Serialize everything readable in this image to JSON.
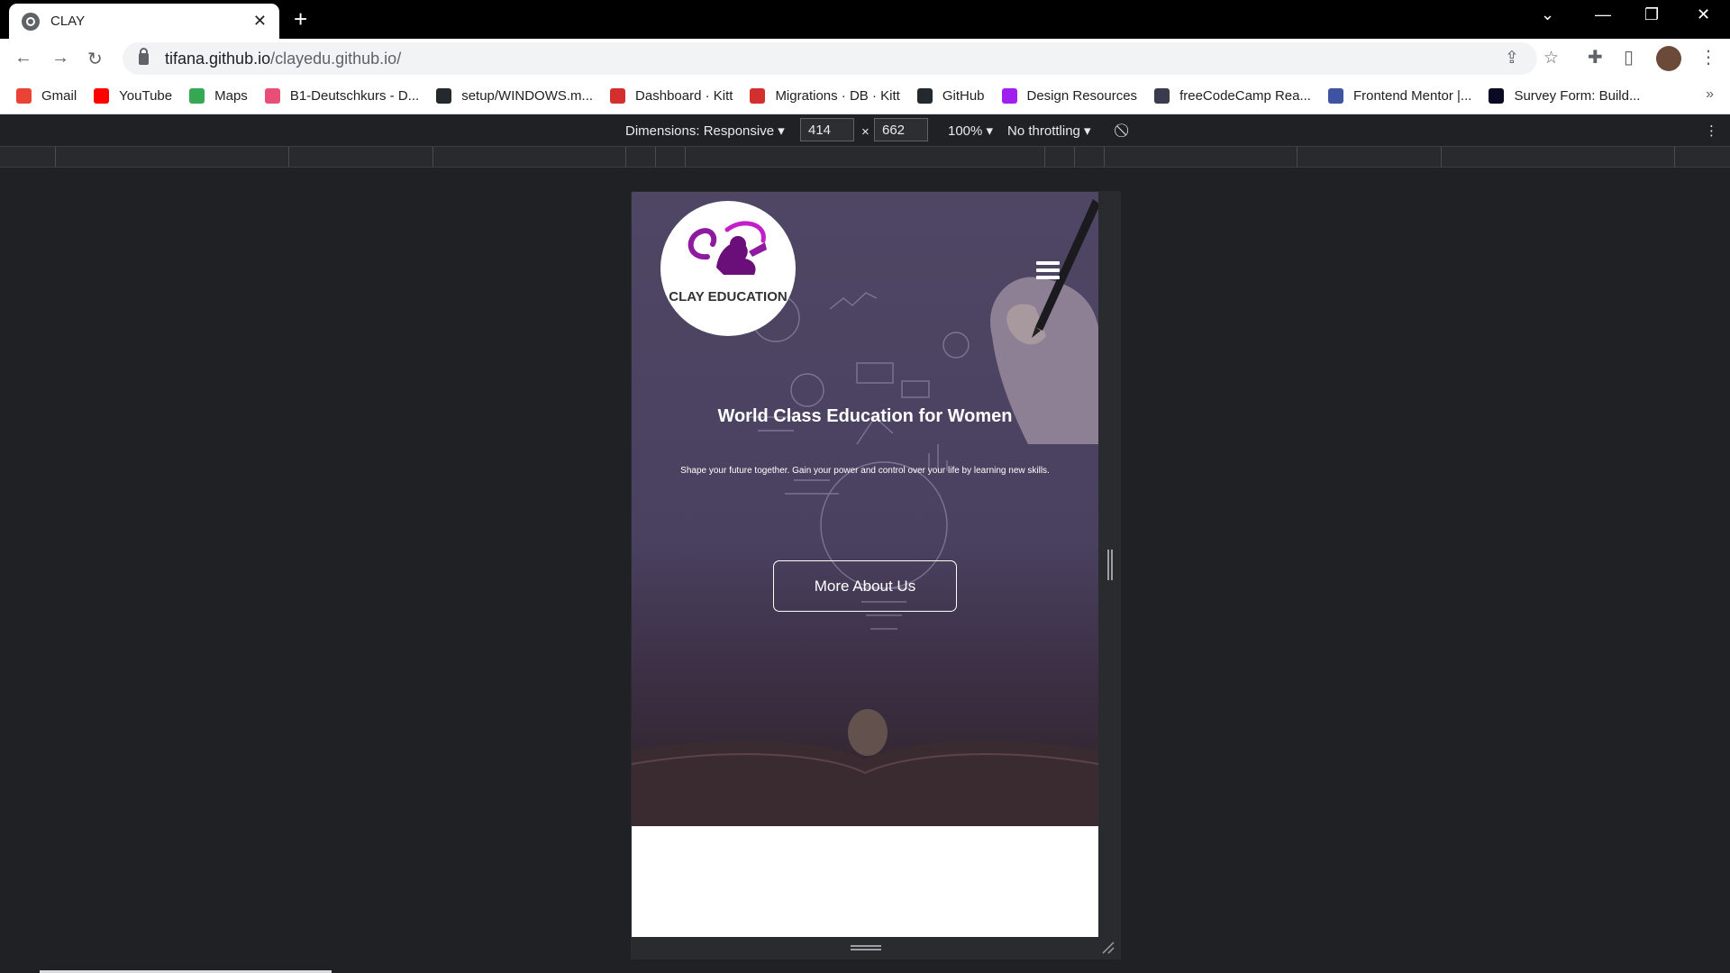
{
  "browser": {
    "tab_title": "CLAY",
    "url_host": "tifana.github.io",
    "url_path": "/clayedu.github.io/",
    "bookmarks": [
      {
        "label": "Gmail",
        "color": "#ea4335"
      },
      {
        "label": "YouTube",
        "color": "#ff0000"
      },
      {
        "label": "Maps",
        "color": "#34a853"
      },
      {
        "label": "B1-Deutschkurs - D...",
        "color": "#e94e77"
      },
      {
        "label": "setup/WINDOWS.m...",
        "color": "#24292e"
      },
      {
        "label": "Dashboard · Kitt",
        "color": "#d32f2f"
      },
      {
        "label": "Migrations · DB · Kitt",
        "color": "#d32f2f"
      },
      {
        "label": "GitHub",
        "color": "#24292e"
      },
      {
        "label": "Design Resources",
        "color": "#a020f0"
      },
      {
        "label": "freeCodeCamp Rea...",
        "color": "#3b3b4f"
      },
      {
        "label": "Frontend Mentor |...",
        "color": "#3e54a3"
      },
      {
        "label": "Survey Form: Build...",
        "color": "#0a0a23"
      }
    ]
  },
  "devtools": {
    "dimensions_label": "Dimensions: Responsive",
    "width": "414",
    "times": "×",
    "height": "662",
    "zoom": "100%",
    "throttling": "No throttling"
  },
  "page": {
    "logo_text": "CLAY EDUCATION",
    "hero_title": "World Class Education for Women",
    "hero_subtitle": "Shape your future together. Gain your power and control over your life by learning new skills.",
    "cta_label": "More About Us",
    "accent_color": "#8e1a9f"
  }
}
